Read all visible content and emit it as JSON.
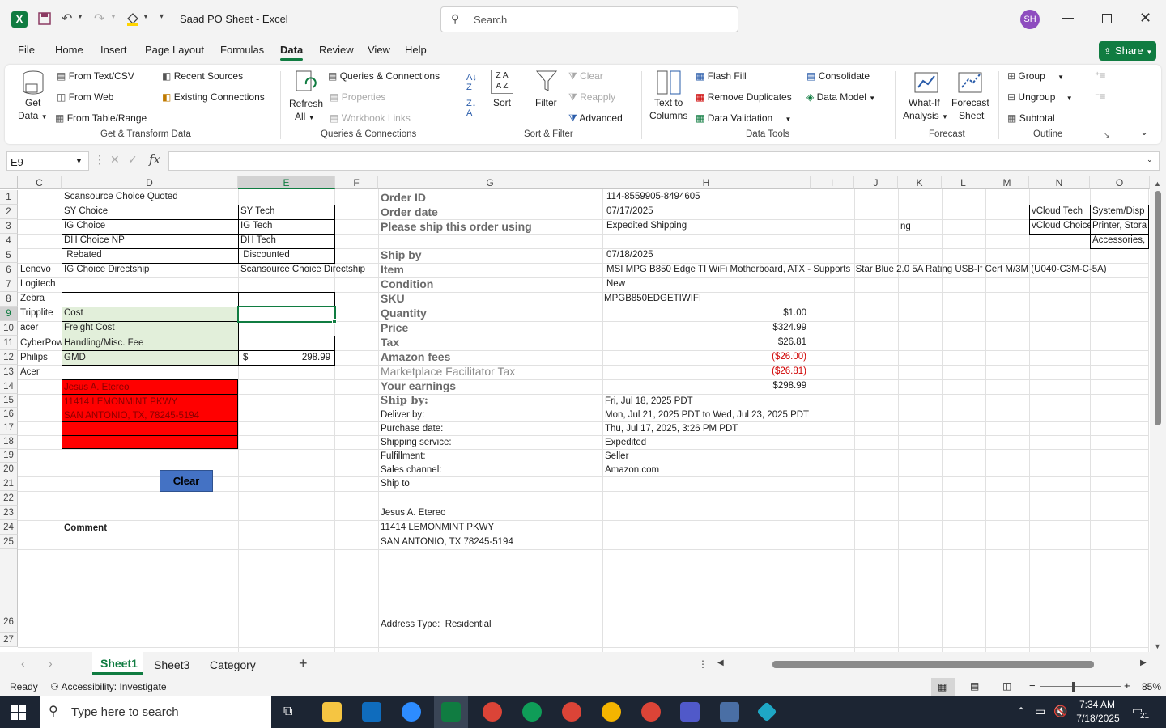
{
  "window": {
    "title": "Saad PO Sheet  -  Excel",
    "search_placeholder": "Search",
    "avatar": "SH"
  },
  "menu": [
    "File",
    "Home",
    "Insert",
    "Page Layout",
    "Formulas",
    "Data",
    "Review",
    "View",
    "Help"
  ],
  "active_menu": "Data",
  "share_label": "Share",
  "ribbon": {
    "get_data": "Get",
    "get_data2": "Data",
    "from_text": "From Text/CSV",
    "from_web": "From Web",
    "from_table": "From Table/Range",
    "recent_sources": "Recent Sources",
    "existing_connections": "Existing Connections",
    "group1": "Get & Transform Data",
    "refresh": "Refresh",
    "refresh_all": "All",
    "queries_connections": "Queries & Connections",
    "properties": "Properties",
    "workbook_links": "Workbook Links",
    "group2": "Queries & Connections",
    "sort": "Sort",
    "filter": "Filter",
    "clear": "Clear",
    "reapply": "Reapply",
    "advanced": "Advanced",
    "group3": "Sort & Filter",
    "text_to_columns": "Text to",
    "text_to_columns2": "Columns",
    "flash_fill": "Flash Fill",
    "remove_duplicates": "Remove Duplicates",
    "data_validation": "Data Validation",
    "consolidate": "Consolidate",
    "data_model": "Data Model",
    "group4": "Data Tools",
    "what_if": "What-If",
    "what_if2": "Analysis",
    "forecast_sheet": "Forecast",
    "forecast_sheet2": "Sheet",
    "group5": "Forecast",
    "group_btn": "Group",
    "ungroup": "Ungroup",
    "subtotal": "Subtotal",
    "group6": "Outline"
  },
  "formula_bar": {
    "name_box": "E9",
    "formula": ""
  },
  "columns": [
    "C",
    "D",
    "E",
    "F",
    "G",
    "H",
    "I",
    "J",
    "K",
    "L",
    "M",
    "N",
    "O"
  ],
  "rows": [
    "1",
    "2",
    "3",
    "4",
    "5",
    "6",
    "7",
    "8",
    "9",
    "10",
    "11",
    "12",
    "13",
    "14",
    "15",
    "16",
    "17",
    "18",
    "19",
    "20",
    "21",
    "22",
    "23",
    "24",
    "25",
    "26",
    "27"
  ],
  "cells": {
    "c6": "Lenovo",
    "c7": "Logitech",
    "c8": "Zebra",
    "c9": "Tripplite",
    "c10": "acer",
    "c11": "CyberPow",
    "c12": "Philips",
    "c13": "Acer",
    "d1": "Scansource Choice Quoted",
    "d2": "SY Choice",
    "d3": "IG Choice",
    "d4": "DH Choice NP",
    "d5": " Rebated",
    "d6": "IG Choice Directship",
    "d9": "Cost",
    "d10": "Freight Cost",
    "d11": "Handling/Misc. Fee",
    "d12": "GMD",
    "d14": "Jesus A. Etereo",
    "d15": "11414 LEMONMINT PKWY",
    "d16": "SAN ANTONIO, TX, 78245-5194",
    "d24": "Comment",
    "e2": "SY Tech",
    "e3": "IG Tech",
    "e4": "DH Tech",
    "e5": " Discounted",
    "e6": "Scansource Choice Directship",
    "e12_cur": "$",
    "e12": "298.99",
    "clear_btn": "Clear",
    "g1": "Order ID",
    "g2": "Order date",
    "g3": "Please ship this order using",
    "g5": "Ship by",
    "g6": "Item",
    "g7": "Condition",
    "g8": "SKU",
    "g9": "Quantity",
    "g10": "Price",
    "g11": "Tax",
    "g12": "Amazon fees",
    "g13": "Marketplace Facilitator Tax",
    "g14": "Your earnings",
    "g15": "Ship by:",
    "g16": "Deliver by:",
    "g17": "Purchase date:",
    "g18": "Shipping service:",
    "g19": "Fulfillment:",
    "g20": "Sales channel:",
    "g21": "Ship to",
    "g23": "Jesus A. Etereo",
    "g24": "11414 LEMONMINT PKWY",
    "g25": "SAN ANTONIO, TX 78245-5194",
    "g26": "Address Type:  Residential",
    "h1": "114-8559905-8494605",
    "h2": "07/17/2025",
    "h3": "Expedited Shipping",
    "h5": "07/18/2025",
    "h6": "MSI MPG B850 Edge TI WiFi Motherboard, ATX - Supports  Star Blue 2.0 5A Rating USB-If Cert M/3M (U040-C3M-C-5A)",
    "h7": "New",
    "h8": "MPGB850EDGETIWIFI",
    "h9": "$1.00",
    "h10": "$324.99",
    "h11": "$26.81",
    "h12": "($26.00)",
    "h13": "($26.81)",
    "h14": "$298.99",
    "h15": "Fri, Jul 18, 2025 PDT",
    "h16": "Mon, Jul 21, 2025 PDT to Wed, Jul 23, 2025 PDT",
    "h17": "Thu, Jul 17, 2025, 3:26 PM PDT",
    "h18": "Expedited",
    "h19": "Seller",
    "h20": "Amazon.com",
    "k3": "ng",
    "n2": "vCloud Tech",
    "n3": "vCloud Choice",
    "o2": "System/Disp",
    "o3": "Printer, Stora",
    "o4": "Accessories,"
  },
  "sheets": [
    "Sheet1",
    "Sheet3",
    "Category"
  ],
  "active_sheet": "Sheet1",
  "status": {
    "ready": "Ready",
    "accessibility": "Accessibility: Investigate",
    "zoom": "85%"
  },
  "taskbar": {
    "search_placeholder": "Type here to search",
    "time": "7:34 AM",
    "date": "7/18/2025",
    "notif": "21"
  }
}
